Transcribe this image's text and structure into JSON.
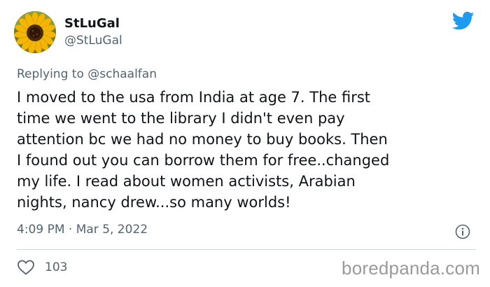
{
  "tweet": {
    "author": {
      "display_name": "StLuGal",
      "handle": "@StLuGal",
      "avatar": "sunflower-avatar"
    },
    "replying_prefix": "Replying to",
    "replying_to": "@schaalfan",
    "text_lines": [
      "I moved to the usa from India at age 7.  The first",
      "time we went to the library I didn't even pay",
      "attention bc we had no money to buy books.  Then",
      "I found out you can borrow them for free..changed",
      "my life.  I read about women activists, Arabian",
      "nights, nancy drew...so many worlds!"
    ],
    "timestamp": "4:09 PM · Mar 5, 2022",
    "likes": "103"
  },
  "icons": {
    "brand": "twitter-bird-icon",
    "info": "info-icon",
    "like": "heart-icon"
  },
  "colors": {
    "twitter_blue": "#1d9bf0",
    "text_primary": "#0f1419",
    "text_secondary": "#536471",
    "divider": "#cfd9de"
  },
  "watermark": "boredpanda.com"
}
